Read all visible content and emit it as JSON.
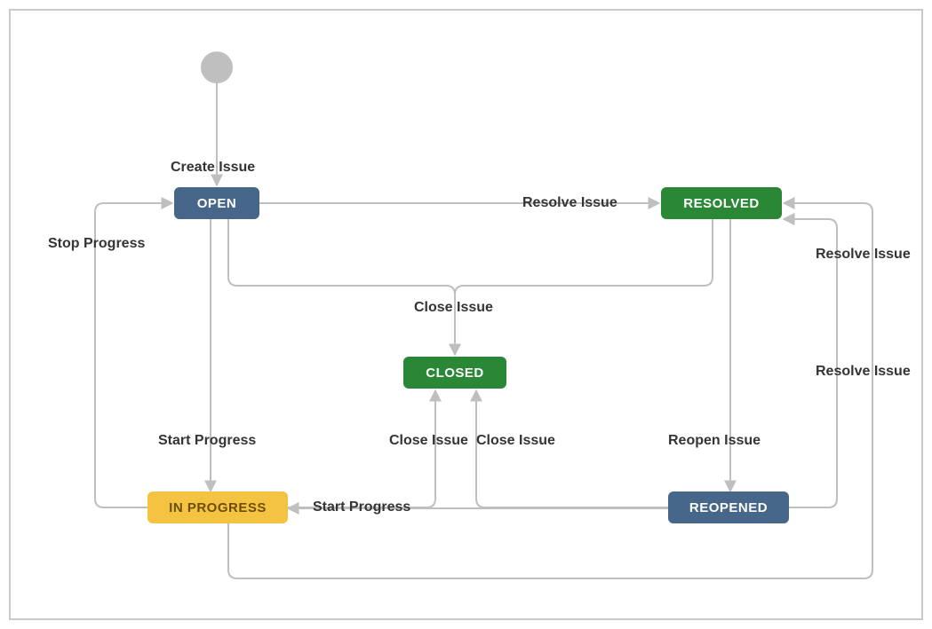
{
  "states": {
    "open": "OPEN",
    "resolved": "RESOLVED",
    "closed": "CLOSED",
    "inprogress": "IN PROGRESS",
    "reopened": "REOPENED"
  },
  "transitions": {
    "create_issue": "Create Issue",
    "resolve_issue_1": "Resolve Issue",
    "resolve_issue_2": "Resolve Issue",
    "resolve_issue_3": "Resolve Issue",
    "close_issue_top": "Close Issue",
    "close_issue_left": "Close Issue",
    "close_issue_right": "Close Issue",
    "stop_progress": "Stop Progress",
    "start_progress_left": "Start Progress",
    "start_progress_mid": "Start Progress",
    "reopen_issue": "Reopen Issue"
  },
  "workflow_edges": [
    {
      "from": "START",
      "to": "OPEN",
      "label": "Create Issue"
    },
    {
      "from": "OPEN",
      "to": "RESOLVED",
      "label": "Resolve Issue"
    },
    {
      "from": "OPEN",
      "to": "CLOSED",
      "label": "Close Issue"
    },
    {
      "from": "OPEN",
      "to": "IN PROGRESS",
      "label": "Start Progress"
    },
    {
      "from": "IN PROGRESS",
      "to": "OPEN",
      "label": "Stop Progress"
    },
    {
      "from": "IN PROGRESS",
      "to": "RESOLVED",
      "label": "Resolve Issue"
    },
    {
      "from": "IN PROGRESS",
      "to": "CLOSED",
      "label": "Close Issue"
    },
    {
      "from": "RESOLVED",
      "to": "CLOSED",
      "label": "Close Issue"
    },
    {
      "from": "RESOLVED",
      "to": "REOPENED",
      "label": "Reopen Issue"
    },
    {
      "from": "REOPENED",
      "to": "RESOLVED",
      "label": "Resolve Issue"
    },
    {
      "from": "REOPENED",
      "to": "CLOSED",
      "label": "Close Issue"
    },
    {
      "from": "REOPENED",
      "to": "IN PROGRESS",
      "label": "Start Progress"
    }
  ]
}
